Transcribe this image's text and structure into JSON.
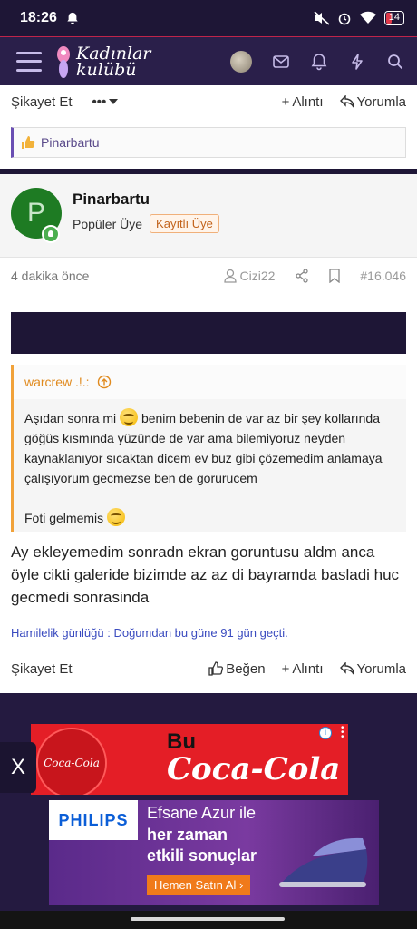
{
  "status_bar": {
    "time": "18:26",
    "battery": "14"
  },
  "header": {
    "logo_line1": "Kadınlar",
    "logo_line2": "kulübü"
  },
  "top_actions": {
    "report": "Şikayet Et",
    "quote": "Alıntı",
    "reply": "Yorumla"
  },
  "liked_by": "Pinarbartu",
  "post": {
    "avatar_letter": "P",
    "author": "Pinarbartu",
    "role": "Popüler Üye",
    "badge": "Kayıtlı Üye",
    "time": "4 dakika önce",
    "share_user": "Cizi22",
    "post_number": "#16.046",
    "quote": {
      "author": "warcrew .!.:",
      "line1": "Aşıdan sonra mi",
      "line1b": "benim bebenin de var az bir şey kollarında göğüs kısmında yüzünde de var ama bilemiyoruz neyden kaynaklanıyor sıcaktan dicem ev buz gibi çözemedim anlamaya çalışıyorum gecmezse ben de gorurucem",
      "line2": "Foti gelmemis"
    },
    "text": "Ay ekleyemedim sonradn ekran goruntusu aldm anca öyle cikti galeride bizimde az az di bayramda basladi huc gecmedi sonrasinda",
    "signature": "Hamilelik günlüğü : Doğumdan bu güne 91 gün geçti."
  },
  "bottom_actions": {
    "report": "Şikayet Et",
    "like": "Beğen",
    "quote": "Alıntı",
    "reply": "Yorumla"
  },
  "ads": {
    "close": "X",
    "coke_circle": "Coca-Cola",
    "coke_bu": "Bu",
    "coke_brand": "Coca-Cola",
    "philips_brand": "PHILIPS",
    "philips_line1": "Efsane Azur ile",
    "philips_line2": "her zaman",
    "philips_line3": "etkili sonuçlar",
    "philips_cta": "Hemen Satın Al ›"
  },
  "colors": {
    "header_bg": "#2a1f4a",
    "accent": "#6a4fb3",
    "quote_accent": "#f1a23a",
    "avatar_bg": "#1e7b23"
  }
}
